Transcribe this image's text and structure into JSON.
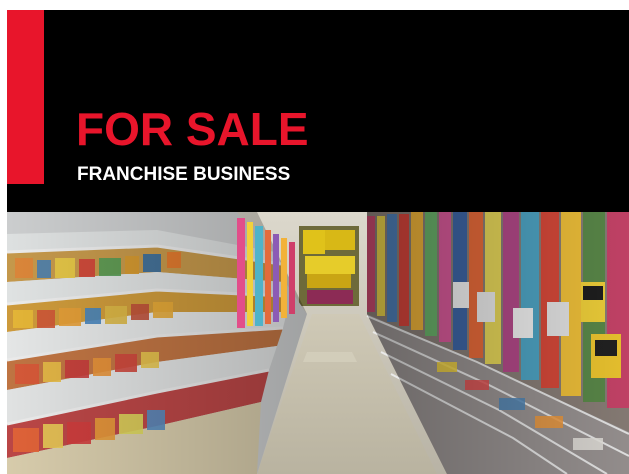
{
  "ad": {
    "headline": "FOR SALE",
    "subheadline": "FRANCHISE BUSINESS"
  },
  "photo": {
    "subject": "store-aisle-photo"
  },
  "colors": {
    "accent": "#e8152b",
    "banner_background": "#000000",
    "subheadline_text": "#ffffff"
  }
}
